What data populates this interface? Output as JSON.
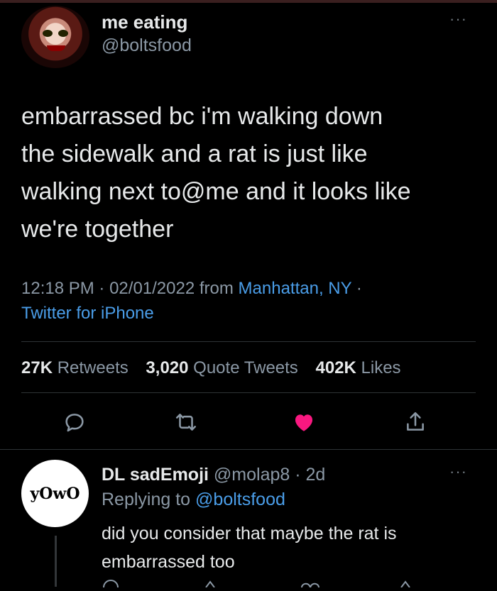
{
  "tweet": {
    "author_name": "me eating",
    "author_handle": "@boltsfood",
    "more_glyph": "···",
    "text": "embarrassed bc i'm walking down\nthe sidewalk and a rat is just like\nwalking next to@me and it looks like\nwe're together",
    "time": "12:18 PM",
    "separator": "·",
    "date": "02/01/2022",
    "from_word": "from",
    "location": "Manhattan, NY",
    "source": "Twitter for iPhone",
    "stats": {
      "retweets_count": "27K",
      "retweets_label": "Retweets",
      "quotes_count": "3,020",
      "quotes_label": "Quote Tweets",
      "likes_count": "402K",
      "likes_label": "Likes"
    },
    "actions": [
      "reply-icon",
      "retweet-icon",
      "like-icon",
      "share-icon"
    ],
    "colors": {
      "like": "#f91880",
      "link": "#4a9de8",
      "muted": "#8b98a5"
    }
  },
  "reply": {
    "avatar_text": "yOwO",
    "author_name": "DL sadEmoji",
    "author_handle": "@molap8",
    "age": "2d",
    "separator": "·",
    "more_glyph": "···",
    "replying_to_label": "Replying to",
    "replying_to_handle": "@boltsfood",
    "text": "did you consider that maybe the rat is\nembarrassed too"
  }
}
